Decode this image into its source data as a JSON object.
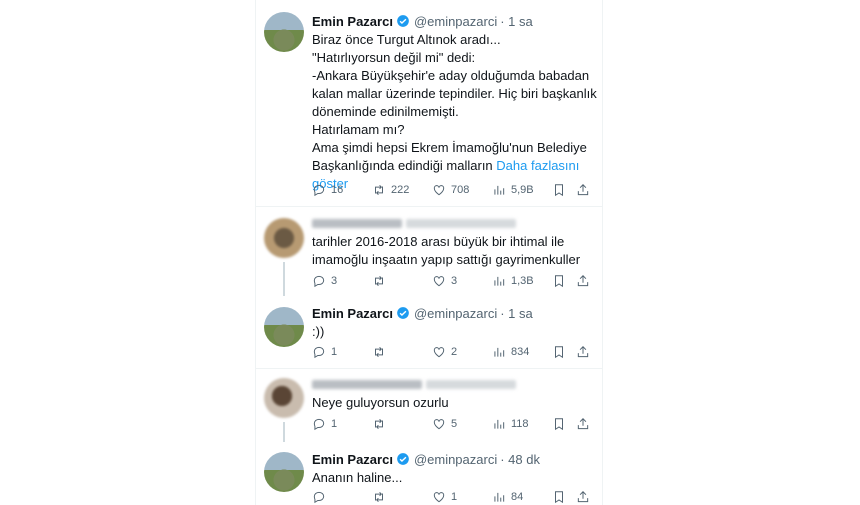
{
  "tweets": [
    {
      "name": "Emin Pazarcı",
      "handle": "@eminpazarci",
      "time": "· 1 sa",
      "text": "Biraz önce Turgut Altınok aradı...\n\"Hatırlıyorsun değil mi\" dedi:\n-Ankara Büyükşehir'e aday olduğumda babadan kalan mallar üzerinde tepindiler. Hiç biri başkanlık döneminde edinilmemişti.\nHatırlamam mı?\nAma şimdi hepsi Ekrem İmamoğlu'nun Belediye Başkanlığında edindiği malların ",
      "more": "Daha fazlasını göster",
      "replies": "16",
      "retweets": "222",
      "likes": "708",
      "views": "5,9B"
    },
    {
      "text": "tarihler 2016-2018 arası büyük bir ihtimal ile imamoğlu inşaatın yapıp sattığı gayrimenkuller",
      "replies": "3",
      "retweets": "",
      "likes": "3",
      "views": "1,3B"
    },
    {
      "name": "Emin Pazarcı",
      "handle": "@eminpazarci",
      "time": "· 1 sa",
      "text": ":))",
      "replies": "1",
      "retweets": "",
      "likes": "2",
      "views": "834"
    },
    {
      "text": "Neye guluyorsun ozurlu",
      "replies": "1",
      "retweets": "",
      "likes": "5",
      "views": "118"
    },
    {
      "name": "Emin Pazarcı",
      "handle": "@eminpazarci",
      "time": "· 48 dk",
      "text": "Ananın haline...",
      "replies": "",
      "retweets": "",
      "likes": "1",
      "views": "84"
    }
  ],
  "colors": {
    "link": "#1d9bf0",
    "muted": "#536471",
    "text": "#0f1419"
  },
  "icons": [
    "verified-badge-icon",
    "reply-icon",
    "retweet-icon",
    "like-icon",
    "views-icon",
    "bookmark-icon",
    "share-icon"
  ]
}
